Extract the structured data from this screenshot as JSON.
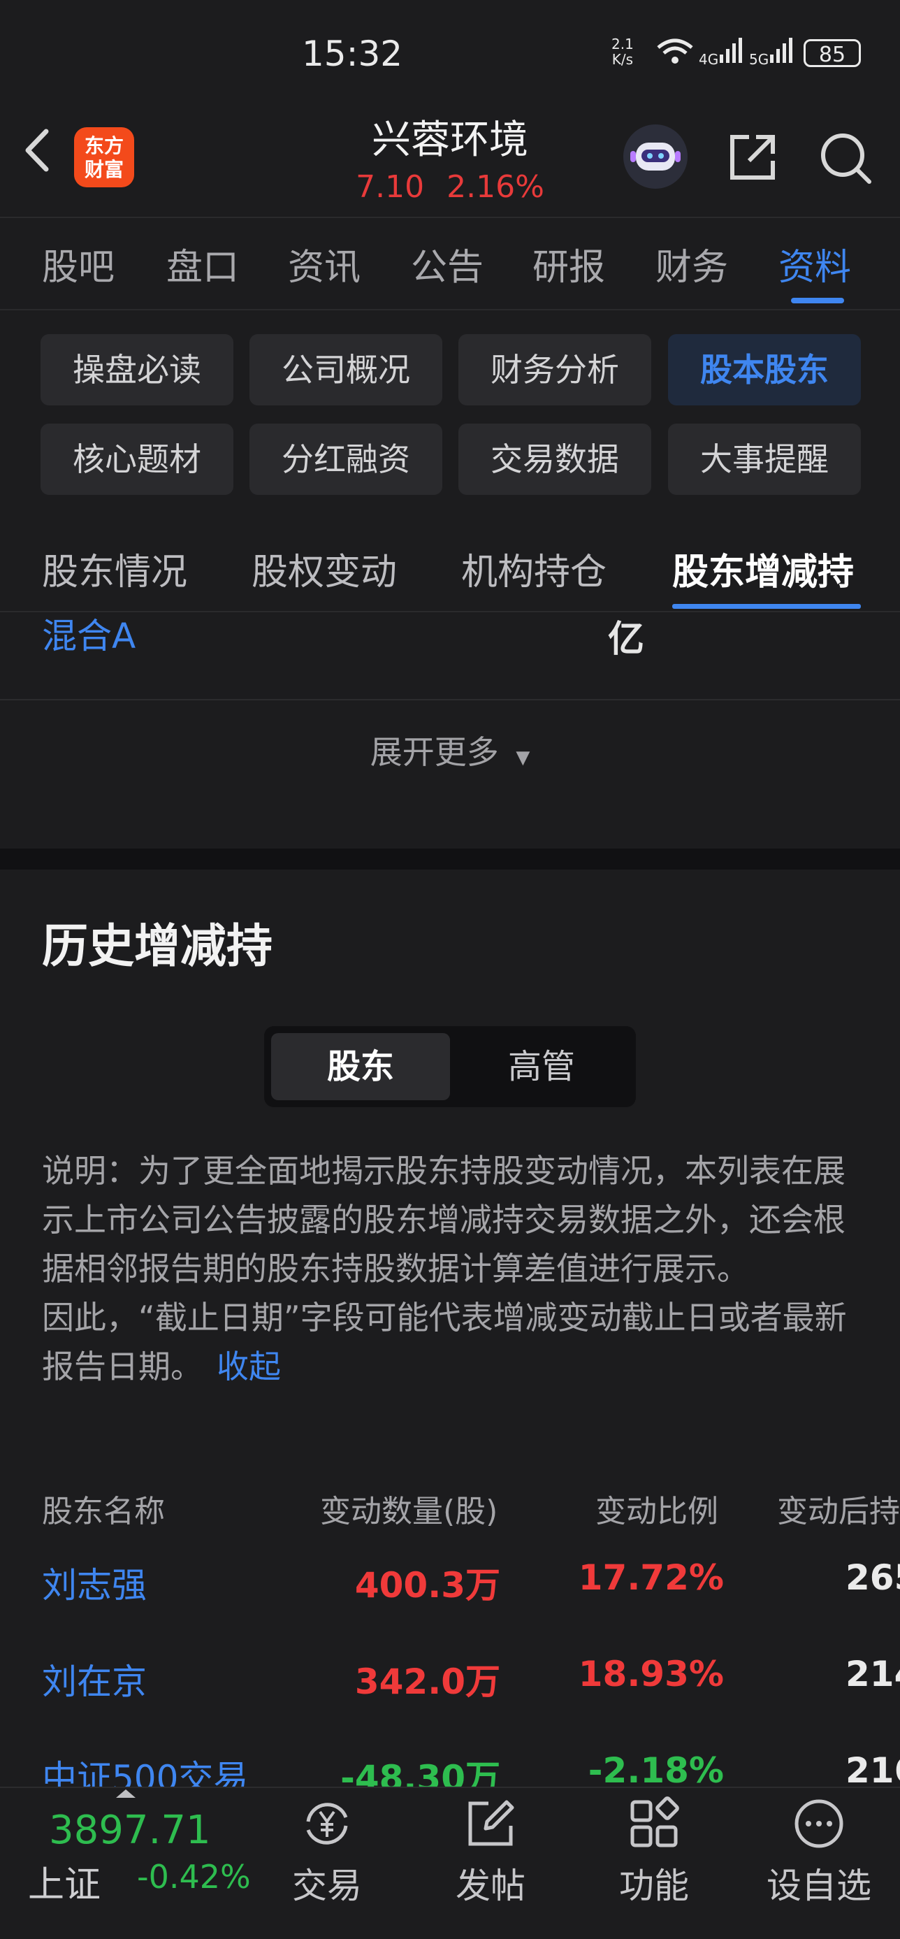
{
  "status_bar": {
    "time": "15:32",
    "net_speed": "2.1\nK/s",
    "signal": "4G 5G",
    "battery": "85"
  },
  "header": {
    "title": "兴蓉环境",
    "price": "7.10",
    "change_pct": "2.16%",
    "logo_text": "东方\n财富"
  },
  "tabs": [
    {
      "label": "股吧"
    },
    {
      "label": "盘口"
    },
    {
      "label": "资讯"
    },
    {
      "label": "公告"
    },
    {
      "label": "研报"
    },
    {
      "label": "财务"
    },
    {
      "label": "资料",
      "active": true
    }
  ],
  "chips": [
    {
      "label": "操盘必读"
    },
    {
      "label": "公司概况"
    },
    {
      "label": "财务分析"
    },
    {
      "label": "股本股东",
      "selected": true
    },
    {
      "label": "核心题材"
    },
    {
      "label": "分红融资"
    },
    {
      "label": "交易数据"
    },
    {
      "label": "大事提醒"
    }
  ],
  "sub_tabs": [
    {
      "label": "股东情况"
    },
    {
      "label": "股权变动"
    },
    {
      "label": "机构持仓"
    },
    {
      "label": "股东增减持",
      "active": true
    }
  ],
  "partial_row": {
    "name": "混合A",
    "value": "亿"
  },
  "expand_label": "展开更多",
  "section": {
    "title": "历史增减持",
    "segments": [
      {
        "label": "股东",
        "active": true
      },
      {
        "label": "高管"
      }
    ],
    "description": "说明：为了更全面地揭示股东持股变动情况，本列表在展示上市公司公告披露的股东增减持交易数据之外，还会根据相邻报告期的股东持股数据计算差值进行展示。\n因此，“截止日期”字段可能代表增减变动截止日或者最新报告日期。",
    "collapse_link": "收起"
  },
  "table": {
    "headers": [
      "股东名称",
      "变动数量(股)",
      "变动比例",
      "变动后持"
    ],
    "rows": [
      {
        "name": "刘志强",
        "qty": "400.3万",
        "pct": "17.72%",
        "after": "265",
        "dir": "up"
      },
      {
        "name": "刘在京",
        "qty": "342.0万",
        "pct": "18.93%",
        "after": "214",
        "dir": "up"
      },
      {
        "name": "中证500交易",
        "qty": "-48.30万",
        "pct": "-2.18%",
        "after": "216",
        "dir": "down"
      }
    ]
  },
  "bottom_nav": {
    "index_value": "3897.71",
    "index_name": "上证",
    "index_pct": "-0.42%",
    "items": [
      {
        "label": "交易",
        "icon": "yen-exchange-icon"
      },
      {
        "label": "发帖",
        "icon": "edit-icon"
      },
      {
        "label": "功能",
        "icon": "grid-icon"
      },
      {
        "label": "设自选",
        "icon": "more-icon"
      }
    ]
  }
}
